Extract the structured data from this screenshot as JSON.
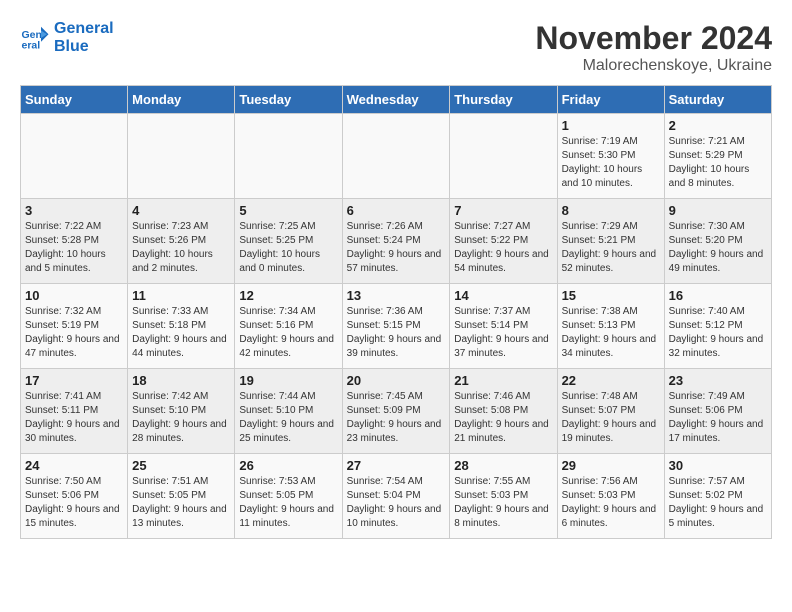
{
  "header": {
    "logo_line1": "General",
    "logo_line2": "Blue",
    "month": "November 2024",
    "location": "Malorechenskoye, Ukraine"
  },
  "weekdays": [
    "Sunday",
    "Monday",
    "Tuesday",
    "Wednesday",
    "Thursday",
    "Friday",
    "Saturday"
  ],
  "weeks": [
    [
      {
        "day": "",
        "info": ""
      },
      {
        "day": "",
        "info": ""
      },
      {
        "day": "",
        "info": ""
      },
      {
        "day": "",
        "info": ""
      },
      {
        "day": "",
        "info": ""
      },
      {
        "day": "1",
        "info": "Sunrise: 7:19 AM\nSunset: 5:30 PM\nDaylight: 10 hours and 10 minutes."
      },
      {
        "day": "2",
        "info": "Sunrise: 7:21 AM\nSunset: 5:29 PM\nDaylight: 10 hours and 8 minutes."
      }
    ],
    [
      {
        "day": "3",
        "info": "Sunrise: 7:22 AM\nSunset: 5:28 PM\nDaylight: 10 hours and 5 minutes."
      },
      {
        "day": "4",
        "info": "Sunrise: 7:23 AM\nSunset: 5:26 PM\nDaylight: 10 hours and 2 minutes."
      },
      {
        "day": "5",
        "info": "Sunrise: 7:25 AM\nSunset: 5:25 PM\nDaylight: 10 hours and 0 minutes."
      },
      {
        "day": "6",
        "info": "Sunrise: 7:26 AM\nSunset: 5:24 PM\nDaylight: 9 hours and 57 minutes."
      },
      {
        "day": "7",
        "info": "Sunrise: 7:27 AM\nSunset: 5:22 PM\nDaylight: 9 hours and 54 minutes."
      },
      {
        "day": "8",
        "info": "Sunrise: 7:29 AM\nSunset: 5:21 PM\nDaylight: 9 hours and 52 minutes."
      },
      {
        "day": "9",
        "info": "Sunrise: 7:30 AM\nSunset: 5:20 PM\nDaylight: 9 hours and 49 minutes."
      }
    ],
    [
      {
        "day": "10",
        "info": "Sunrise: 7:32 AM\nSunset: 5:19 PM\nDaylight: 9 hours and 47 minutes."
      },
      {
        "day": "11",
        "info": "Sunrise: 7:33 AM\nSunset: 5:18 PM\nDaylight: 9 hours and 44 minutes."
      },
      {
        "day": "12",
        "info": "Sunrise: 7:34 AM\nSunset: 5:16 PM\nDaylight: 9 hours and 42 minutes."
      },
      {
        "day": "13",
        "info": "Sunrise: 7:36 AM\nSunset: 5:15 PM\nDaylight: 9 hours and 39 minutes."
      },
      {
        "day": "14",
        "info": "Sunrise: 7:37 AM\nSunset: 5:14 PM\nDaylight: 9 hours and 37 minutes."
      },
      {
        "day": "15",
        "info": "Sunrise: 7:38 AM\nSunset: 5:13 PM\nDaylight: 9 hours and 34 minutes."
      },
      {
        "day": "16",
        "info": "Sunrise: 7:40 AM\nSunset: 5:12 PM\nDaylight: 9 hours and 32 minutes."
      }
    ],
    [
      {
        "day": "17",
        "info": "Sunrise: 7:41 AM\nSunset: 5:11 PM\nDaylight: 9 hours and 30 minutes."
      },
      {
        "day": "18",
        "info": "Sunrise: 7:42 AM\nSunset: 5:10 PM\nDaylight: 9 hours and 28 minutes."
      },
      {
        "day": "19",
        "info": "Sunrise: 7:44 AM\nSunset: 5:10 PM\nDaylight: 9 hours and 25 minutes."
      },
      {
        "day": "20",
        "info": "Sunrise: 7:45 AM\nSunset: 5:09 PM\nDaylight: 9 hours and 23 minutes."
      },
      {
        "day": "21",
        "info": "Sunrise: 7:46 AM\nSunset: 5:08 PM\nDaylight: 9 hours and 21 minutes."
      },
      {
        "day": "22",
        "info": "Sunrise: 7:48 AM\nSunset: 5:07 PM\nDaylight: 9 hours and 19 minutes."
      },
      {
        "day": "23",
        "info": "Sunrise: 7:49 AM\nSunset: 5:06 PM\nDaylight: 9 hours and 17 minutes."
      }
    ],
    [
      {
        "day": "24",
        "info": "Sunrise: 7:50 AM\nSunset: 5:06 PM\nDaylight: 9 hours and 15 minutes."
      },
      {
        "day": "25",
        "info": "Sunrise: 7:51 AM\nSunset: 5:05 PM\nDaylight: 9 hours and 13 minutes."
      },
      {
        "day": "26",
        "info": "Sunrise: 7:53 AM\nSunset: 5:05 PM\nDaylight: 9 hours and 11 minutes."
      },
      {
        "day": "27",
        "info": "Sunrise: 7:54 AM\nSunset: 5:04 PM\nDaylight: 9 hours and 10 minutes."
      },
      {
        "day": "28",
        "info": "Sunrise: 7:55 AM\nSunset: 5:03 PM\nDaylight: 9 hours and 8 minutes."
      },
      {
        "day": "29",
        "info": "Sunrise: 7:56 AM\nSunset: 5:03 PM\nDaylight: 9 hours and 6 minutes."
      },
      {
        "day": "30",
        "info": "Sunrise: 7:57 AM\nSunset: 5:02 PM\nDaylight: 9 hours and 5 minutes."
      }
    ]
  ]
}
